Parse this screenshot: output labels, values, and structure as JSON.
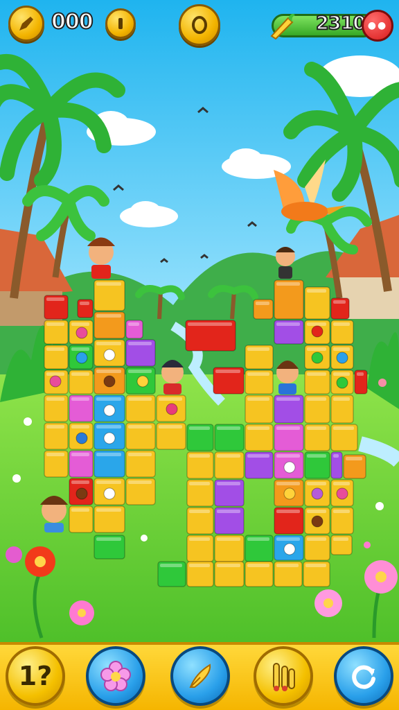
{
  "hud": {
    "left_counter": "000",
    "pause_icon": "pause-icon",
    "coin_icon": "coin-icon",
    "score": "2310",
    "boost_icon": "carrot-icon",
    "menu_icon": "more-icon"
  },
  "bottom_bar": {
    "hint_button_label": "1?",
    "hint_icon": "hint-icon",
    "flower_icon": "flower-icon",
    "feather_icon": "feather-icon",
    "bars_icon": "bars-icon",
    "refresh_icon": "refresh-icon"
  },
  "colors": {
    "sky_top": "#1fb4ef",
    "grass": "#7fdb3a",
    "hud_gold": "#f3b400",
    "score_green": "#37a826",
    "menu_red": "#d81a1a",
    "block_yellow": "#f6c421",
    "block_orange": "#f39a1c",
    "block_red": "#e2251b",
    "block_purple": "#a24ee6",
    "block_pink": "#e45cd6",
    "block_green": "#2fc83a",
    "block_blue": "#2aa6ea"
  }
}
